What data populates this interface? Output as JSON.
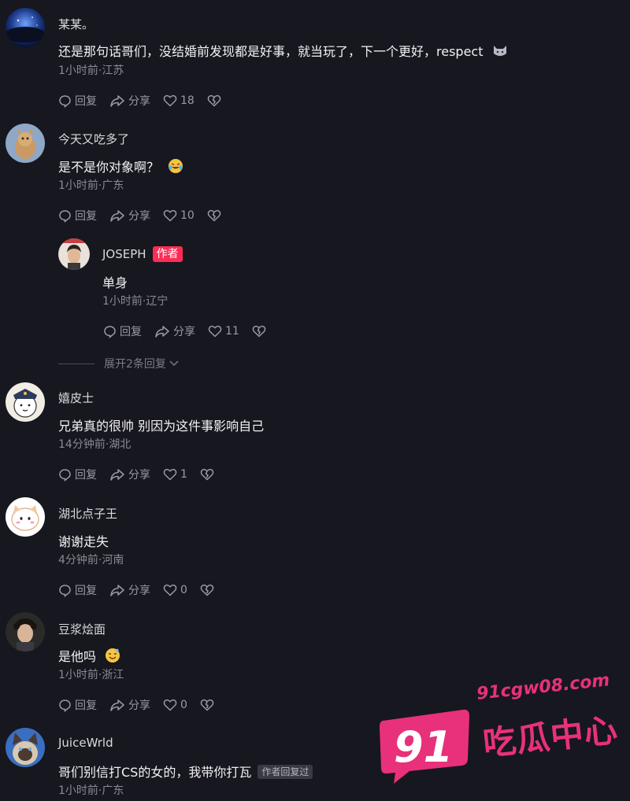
{
  "actions": {
    "reply_label": "回复",
    "share_label": "分享"
  },
  "comments": [
    {
      "username": "某某。",
      "text": "还是那句话哥们，没结婚前发现都是好事，就当玩了，下一个更好，respect",
      "meta": "1小时前·江苏",
      "likes": "18",
      "avatar": "blue-planet-avatar"
    },
    {
      "username": "今天又吃多了",
      "text": "是不是你对象啊？",
      "meta": "1小时前·广东",
      "likes": "10",
      "avatar": "cartoon-animal-avatar"
    },
    {
      "username": "嬉皮士",
      "text": "兄弟真的很帅 别因为这件事影响自己",
      "meta": "14分钟前·湖北",
      "likes": "1",
      "avatar": "police-cartoon-avatar"
    },
    {
      "username": "湖北点子王",
      "text": "谢谢走失",
      "meta": "4分钟前·河南",
      "likes": "0",
      "avatar": "white-cat-avatar"
    },
    {
      "username": "豆浆烩面",
      "text": "是他吗",
      "meta": "1小时前·浙江",
      "likes": "0",
      "avatar": "curly-hair-person-avatar"
    },
    {
      "username": "JuiceWrld",
      "text": "哥们别信打CS的女的，我带你打瓦",
      "meta": "1小时前·广东",
      "badge": "作者回复过",
      "avatar": "siamese-cat-avatar"
    }
  ],
  "reply": {
    "username": "JOSEPH",
    "badge": "作者",
    "text": "单身",
    "meta": "1小时前·辽宁",
    "likes": "11",
    "avatar": "person-portrait-avatar"
  },
  "expand_label": "展开2条回复",
  "watermark": {
    "logo_number": "91",
    "url": "91cgw08.com",
    "name": "吃瓜中心"
  },
  "colors": {
    "background": "#17171f",
    "author_badge": "#fe2c55",
    "watermark": "#e8317a"
  }
}
